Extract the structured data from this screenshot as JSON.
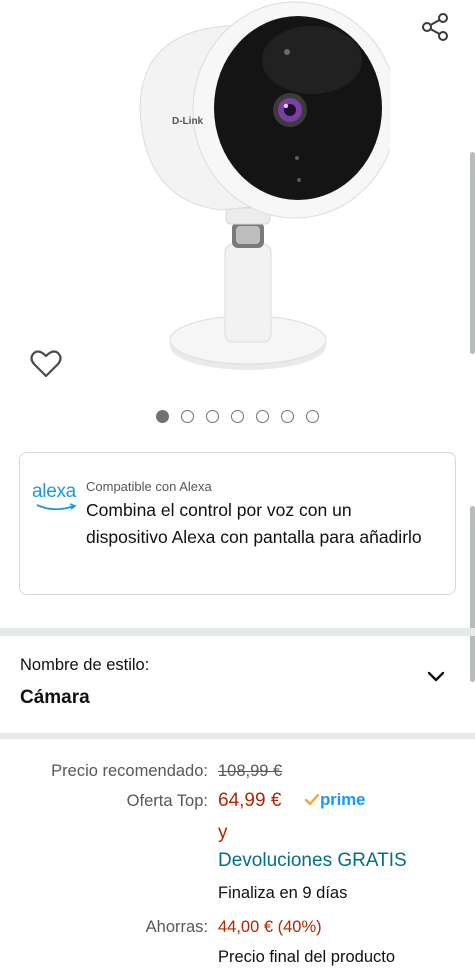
{
  "product": {
    "brand_on_device": "D-Link"
  },
  "gallery": {
    "image_count": 7,
    "active_index": 0,
    "share_icon": "share-icon",
    "wishlist_icon": "heart-icon"
  },
  "alexa": {
    "logo_text": "alexa",
    "badge": "Compatible con Alexa",
    "description": "Combina el control por voz con un dispositivo Alexa con pantalla para añadirlo"
  },
  "style": {
    "label": "Nombre de estilo:",
    "value": "Cámara"
  },
  "price": {
    "list_label": "Precio recomendado:",
    "list_value": "108,99 €",
    "deal_label": "Oferta Top:",
    "deal_value": "64,99 €",
    "prime_label": "prime",
    "and_text": "y",
    "returns_text": "Devoluciones GRATIS",
    "ends_text": "Finaliza en 9 días",
    "savings_label": "Ahorras:",
    "savings_value": "44,00 € (40%)",
    "final_text": "Precio final del producto"
  },
  "colors": {
    "accent_price": "#b12704",
    "link": "#007185",
    "prime_blue": "#1a98ff",
    "prime_check": "#f7a62e"
  }
}
